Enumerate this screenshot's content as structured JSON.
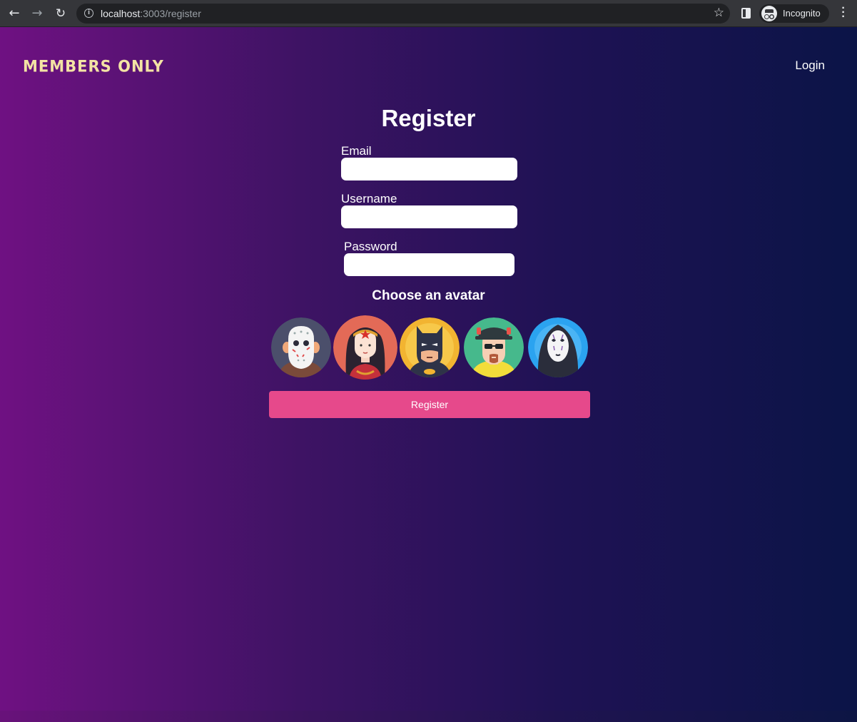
{
  "browser": {
    "url_host": "localhost",
    "url_path": ":3003/register",
    "profile_label": "Incognito",
    "icons": [
      "back-arrow-icon",
      "forward-arrow-icon",
      "reload-icon",
      "info-icon",
      "star-icon",
      "side-panel-icon",
      "incognito-icon",
      "more-menu-icon"
    ]
  },
  "header": {
    "logo": "MEMBERS ONLY",
    "login_link": "Login"
  },
  "form": {
    "title": "Register",
    "email_label": "Email",
    "email_value": "",
    "username_label": "Username",
    "username_value": "",
    "password_label": "Password",
    "password_value": "",
    "avatar_heading": "Choose an avatar",
    "avatars": [
      "jason-avatar",
      "wonder-woman-avatar",
      "batman-avatar",
      "heisenberg-avatar",
      "no-face-avatar"
    ],
    "submit_label": "Register"
  },
  "colors": {
    "gradient_left": "#6f1182",
    "gradient_right": "#0b1447",
    "logo": "#f3e3a4",
    "button": "#e6498b"
  }
}
